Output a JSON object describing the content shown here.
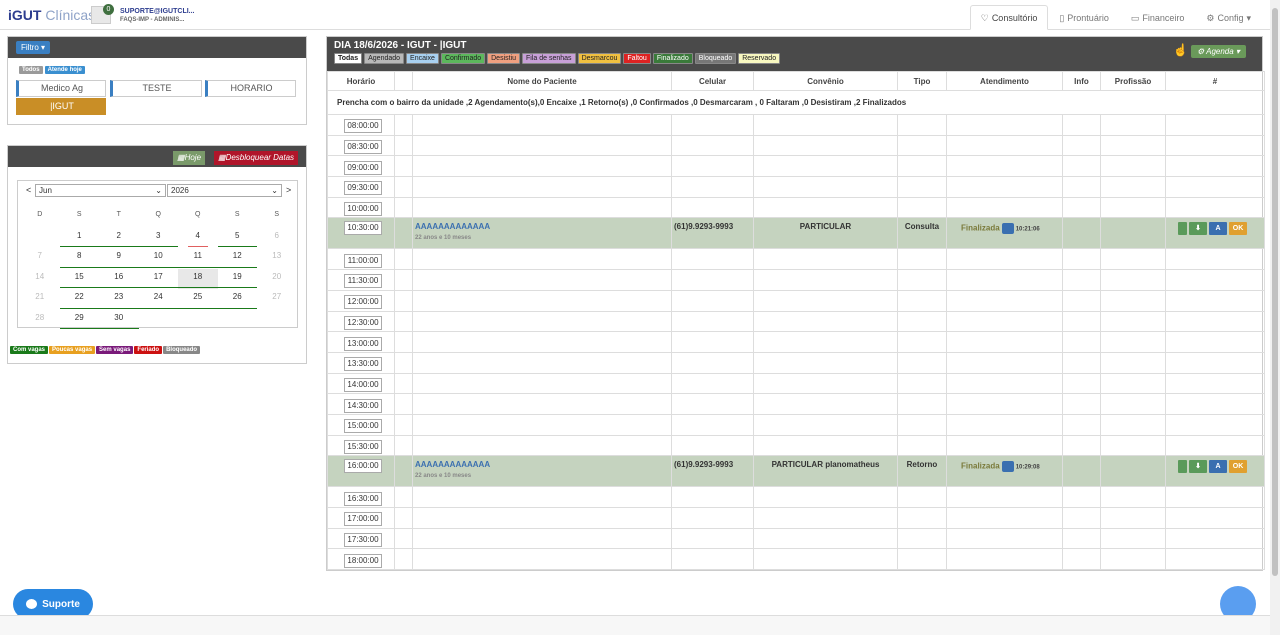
{
  "brand": {
    "strong": "iGUT",
    "light": "Clínicas"
  },
  "user": {
    "badge": "0",
    "name": "SUPORTE@IGUTCLI...",
    "role": "FAQS-IMP - ADMINIS..."
  },
  "nav": [
    {
      "icon": "stethoscope-icon",
      "glyph": "♡",
      "label": "Consultório"
    },
    {
      "icon": "book-icon",
      "glyph": "▯",
      "label": "Prontuário"
    },
    {
      "icon": "money-icon",
      "glyph": "▭",
      "label": "Financeiro"
    },
    {
      "icon": "gear-icon",
      "glyph": "⚙",
      "label": "Config"
    }
  ],
  "filter": {
    "button": "Filtro",
    "chips": [
      {
        "label": "Todos",
        "color": "#9a9a9a"
      },
      {
        "label": "Atende hoje",
        "color": "#3a8fd0"
      }
    ],
    "doctors": [
      "Medico Ag",
      "TESTE",
      "HORARIO",
      "|IGUT"
    ]
  },
  "calendar": {
    "hoje": "Hoje",
    "desbloquear": "Desbloquear Datas",
    "prev": "<",
    "next": ">",
    "month": "Jun",
    "year": "2026",
    "dow": [
      "D",
      "S",
      "T",
      "Q",
      "Q",
      "S",
      "S"
    ],
    "weeks": [
      [
        "",
        "1",
        "2",
        "3",
        "4",
        "5",
        "6"
      ],
      [
        "7",
        "8",
        "9",
        "10",
        "11",
        "12",
        "13"
      ],
      [
        "14",
        "15",
        "16",
        "17",
        "18",
        "19",
        "20"
      ],
      [
        "21",
        "22",
        "23",
        "24",
        "25",
        "26",
        "27"
      ],
      [
        "28",
        "29",
        "30",
        "",
        "",
        "",
        ""
      ]
    ],
    "legend": [
      {
        "label": "Com vagas",
        "color": "#1a7a1a"
      },
      {
        "label": "Poucas vagas",
        "color": "#e8a020"
      },
      {
        "label": "Sem vagas",
        "color": "#7a1a7a"
      },
      {
        "label": "Feriado",
        "color": "#cc1111"
      },
      {
        "label": "Bloqueado",
        "color": "#888888"
      }
    ]
  },
  "agenda": {
    "title": "DIA 18/6/2026 - IGUT - |IGUT",
    "agenda_btn": "Agenda",
    "statuses": [
      {
        "label": "Todas",
        "color": "#ffffff"
      },
      {
        "label": "Agendado",
        "color": "#b8b8b8"
      },
      {
        "label": "Encaixe",
        "color": "#a8d0f0"
      },
      {
        "label": "Confirmado",
        "color": "#5cb85c"
      },
      {
        "label": "Desistiu",
        "color": "#f0a080"
      },
      {
        "label": "Fila de senhas",
        "color": "#c8a0d8"
      },
      {
        "label": "Desmarcou",
        "color": "#f0c040"
      },
      {
        "label": "Faltou",
        "color": "#dd2222"
      },
      {
        "label": "Finalizado",
        "color": "#3a7a3a"
      },
      {
        "label": "Bloqueado",
        "color": "#777777"
      },
      {
        "label": "Reservado",
        "color": "#f8f8c0"
      }
    ],
    "columns": [
      "Horário",
      "Nome do Paciente",
      "Celular",
      "Convênio",
      "Tipo",
      "Atendimento",
      "Info",
      "Profissão",
      "#"
    ],
    "summary": "Prencha com o bairro da unidade ,2 Agendamento(s),0 Encaixe ,1 Retorno(s) ,0 Confirmados ,0 Desmarcaram , 0 Faltaram ,0 Desistiram ,2 Finalizados",
    "slots": [
      {
        "time": "08:00:00"
      },
      {
        "time": "08:30:00"
      },
      {
        "time": "09:00:00"
      },
      {
        "time": "09:30:00"
      },
      {
        "time": "10:00:00"
      },
      {
        "time": "10:30:00",
        "patient": "AAAAAAAAAAAAA",
        "age": "22 anos e 10 meses",
        "phone": "(61)9.9293-9993",
        "insurance": "PARTICULAR",
        "type": "Consulta",
        "status": "Finalizada",
        "status_time": "10:21:06"
      },
      {
        "time": "11:00:00"
      },
      {
        "time": "11:30:00"
      },
      {
        "time": "12:00:00"
      },
      {
        "time": "12:30:00"
      },
      {
        "time": "13:00:00"
      },
      {
        "time": "13:30:00"
      },
      {
        "time": "14:00:00"
      },
      {
        "time": "14:30:00"
      },
      {
        "time": "15:00:00"
      },
      {
        "time": "15:30:00"
      },
      {
        "time": "16:00:00",
        "patient": "AAAAAAAAAAAAA",
        "age": "22 anos e 10 meses",
        "phone": "(61)9.9293-9993",
        "insurance": "PARTICULAR planomatheus",
        "type": "Retorno",
        "status": "Finalizada",
        "status_time": "10:29:08"
      },
      {
        "time": "16:30:00"
      },
      {
        "time": "17:00:00"
      },
      {
        "time": "17:30:00"
      },
      {
        "time": "18:00:00"
      }
    ],
    "action_ok": "OK",
    "action_a": "A"
  },
  "support": {
    "label": "Suporte"
  }
}
